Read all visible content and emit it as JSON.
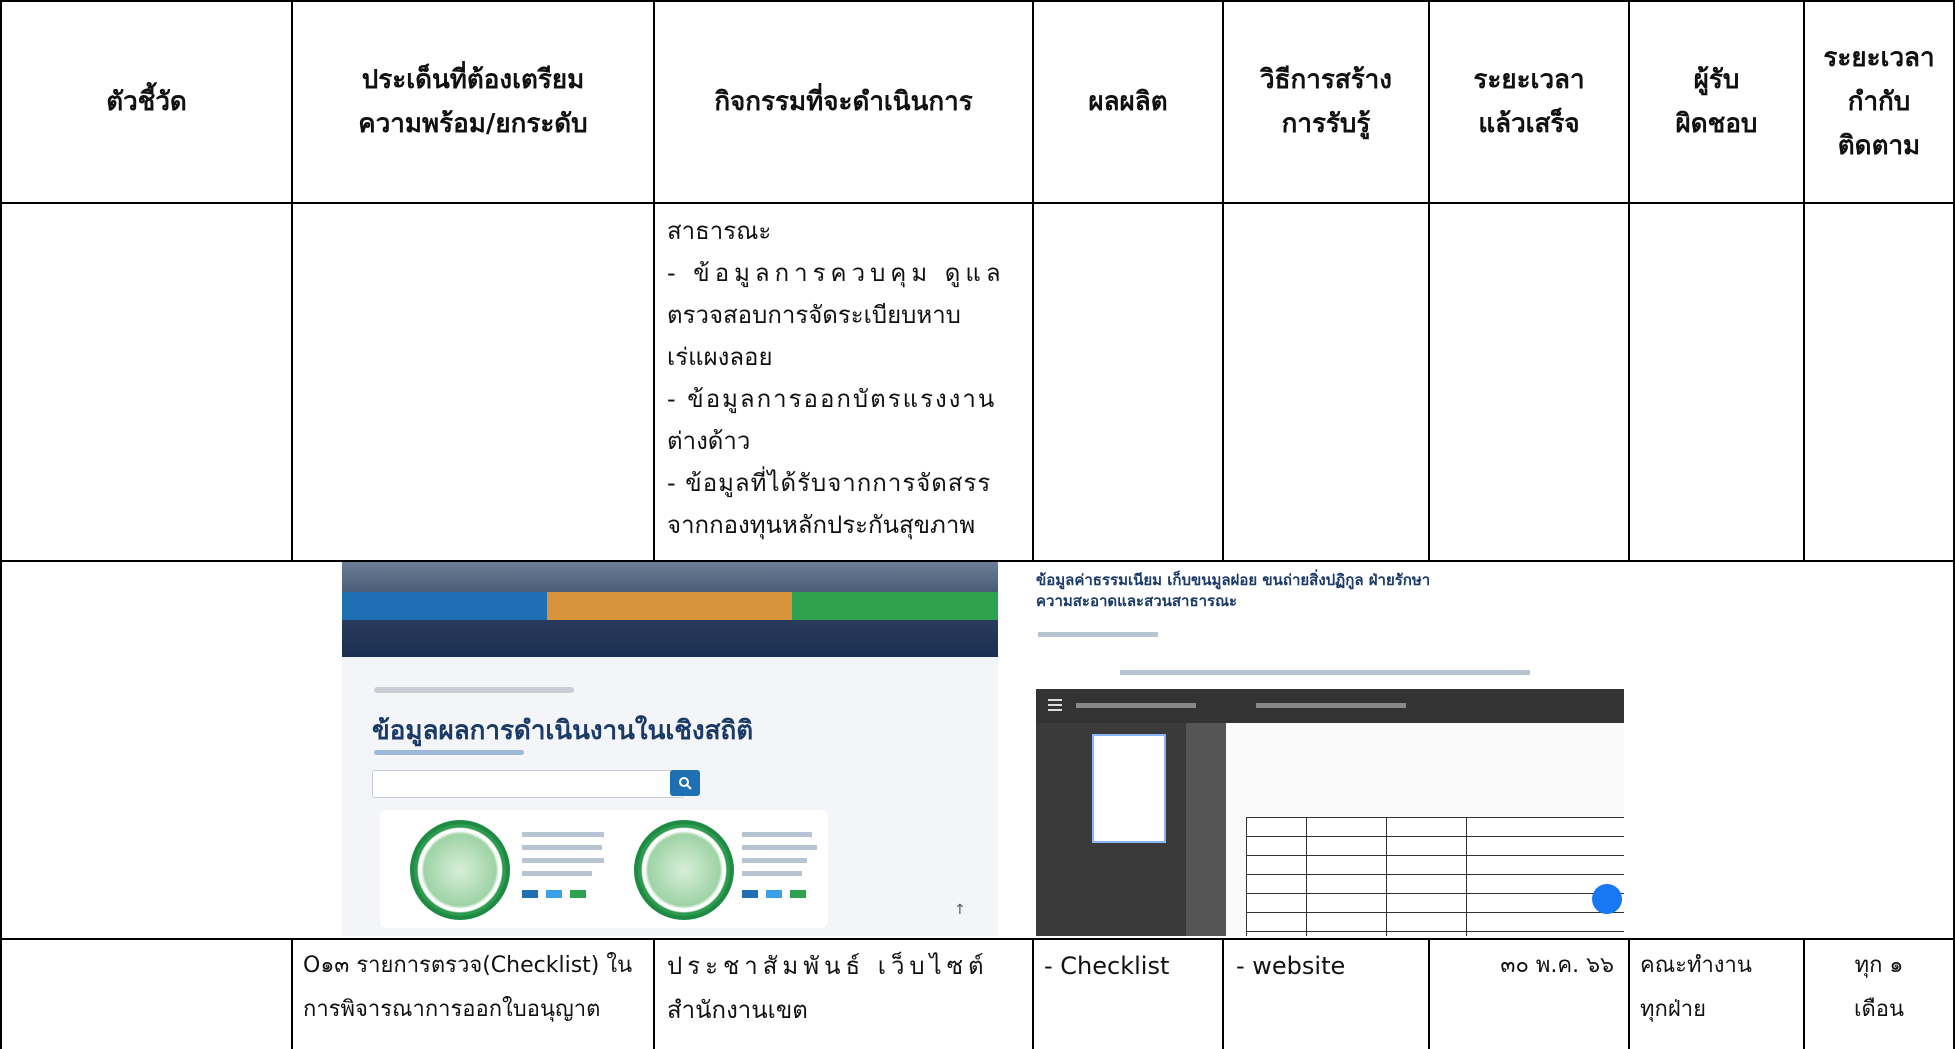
{
  "headers": {
    "col1": "ตัวชี้วัด",
    "col2_line1": "ประเด็นที่ต้องเตรียม",
    "col2_line2": "ความพร้อม/ยกระดับ",
    "col3": "กิจกรรมที่จะดำเนินการ",
    "col4": "ผลผลิต",
    "col5_line1": "วิธีการสร้าง",
    "col5_line2": "การรับรู้",
    "col6_line1": "ระยะเวลา",
    "col6_line2": "แล้วเสร็จ",
    "col7_line1": "ผู้รับ",
    "col7_line2": "ผิดชอบ",
    "col8_line1": "ระยะเวลา",
    "col8_line2": "กำกับ",
    "col8_line3": "ติดตาม"
  },
  "row1": {
    "activities": [
      "สาธารณะ",
      "- ข้อมูลการควบคุม ดูแล",
      "ตรวจสอบการจัดระเบียบหาบ",
      "เร่แผงลอย",
      "- ข้อมูลการออกบัตรแรงงาน",
      "ต่างด้าว",
      "- ข้อมูลที่ได้รับจากการจัดสรร",
      "จากกองทุนหลักประกันสุขภาพ"
    ]
  },
  "screenshot_left": {
    "title": "ข้อมูลผลการดำเนินงานในเชิงสถิติ",
    "icon": "search-icon"
  },
  "screenshot_right": {
    "title_line1": "ข้อมูลค่าธรรมเนียม เก็บขนมูลฝอย ขนถ่ายสิ่งปฏิกูล ฝ่ายรักษา",
    "title_line2": "ความสะอาดและสวนสาธารณะ"
  },
  "row2": {
    "issue_line1": "O๑๓ รายการตรวจ(Checklist) ใน",
    "issue_line2": "การพิจารณาการออกใบอนุญาต",
    "activity_line1": "ประชาสัมพันธ์ เว็บไซต์",
    "activity_line2": "สำนักงานเขต",
    "output": "- Checklist",
    "channel": "- website",
    "deadline": "๓๐ พ.ค. ๖๖",
    "responsible_line1": "คณะทำงาน",
    "responsible_line2": "ทุกฝ่าย",
    "monitor_line1": "ทุก ๑",
    "monitor_line2": "เดือน"
  },
  "colors": {
    "blue": "#1f6fb5",
    "orange": "#d8943a",
    "green": "#2ea14f",
    "navy": "#1b2f52"
  }
}
